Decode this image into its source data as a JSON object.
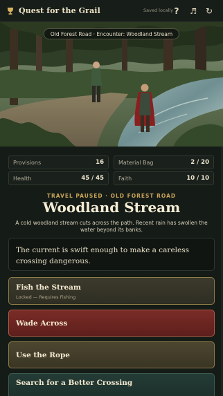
{
  "app": {
    "title": "Quest for the Grail",
    "save_status": "Saved locally"
  },
  "toolbar": {
    "help_label": "?",
    "music_label": "♬",
    "restart_label": "↻",
    "icons": [
      "grail-icon",
      "help-icon",
      "music-icon",
      "restart-icon"
    ]
  },
  "scene": {
    "location_label": "Old Forest Road · Encounter: Woodland Stream"
  },
  "stats": {
    "provisions": {
      "label": "Provisions",
      "value": "16"
    },
    "material_bag": {
      "label": "Material Bag",
      "value": "2 / 20"
    },
    "health": {
      "label": "Health",
      "value": "45 / 45"
    },
    "faith": {
      "label": "Faith",
      "value": "10 / 10"
    }
  },
  "encounter": {
    "kicker": "TRAVEL PAUSED · OLD FOREST ROAD",
    "title": "Woodland Stream",
    "description": "A cold woodland stream cuts across the path. Recent rain has swollen the water beyond its banks.",
    "narrative": "The current is swift enough to make a careless crossing dangerous."
  },
  "choices": [
    {
      "title": "Fish the Stream",
      "subtitle": "Locked — Requires Fishing"
    },
    {
      "title": "Wade Across"
    },
    {
      "title": "Use the Rope"
    },
    {
      "title": "Search for a Better Crossing"
    }
  ],
  "colors": {
    "background": "#151b16",
    "accent_gold": "#c9a55a",
    "danger_red": "#7a2c27",
    "teal": "#243b35"
  }
}
